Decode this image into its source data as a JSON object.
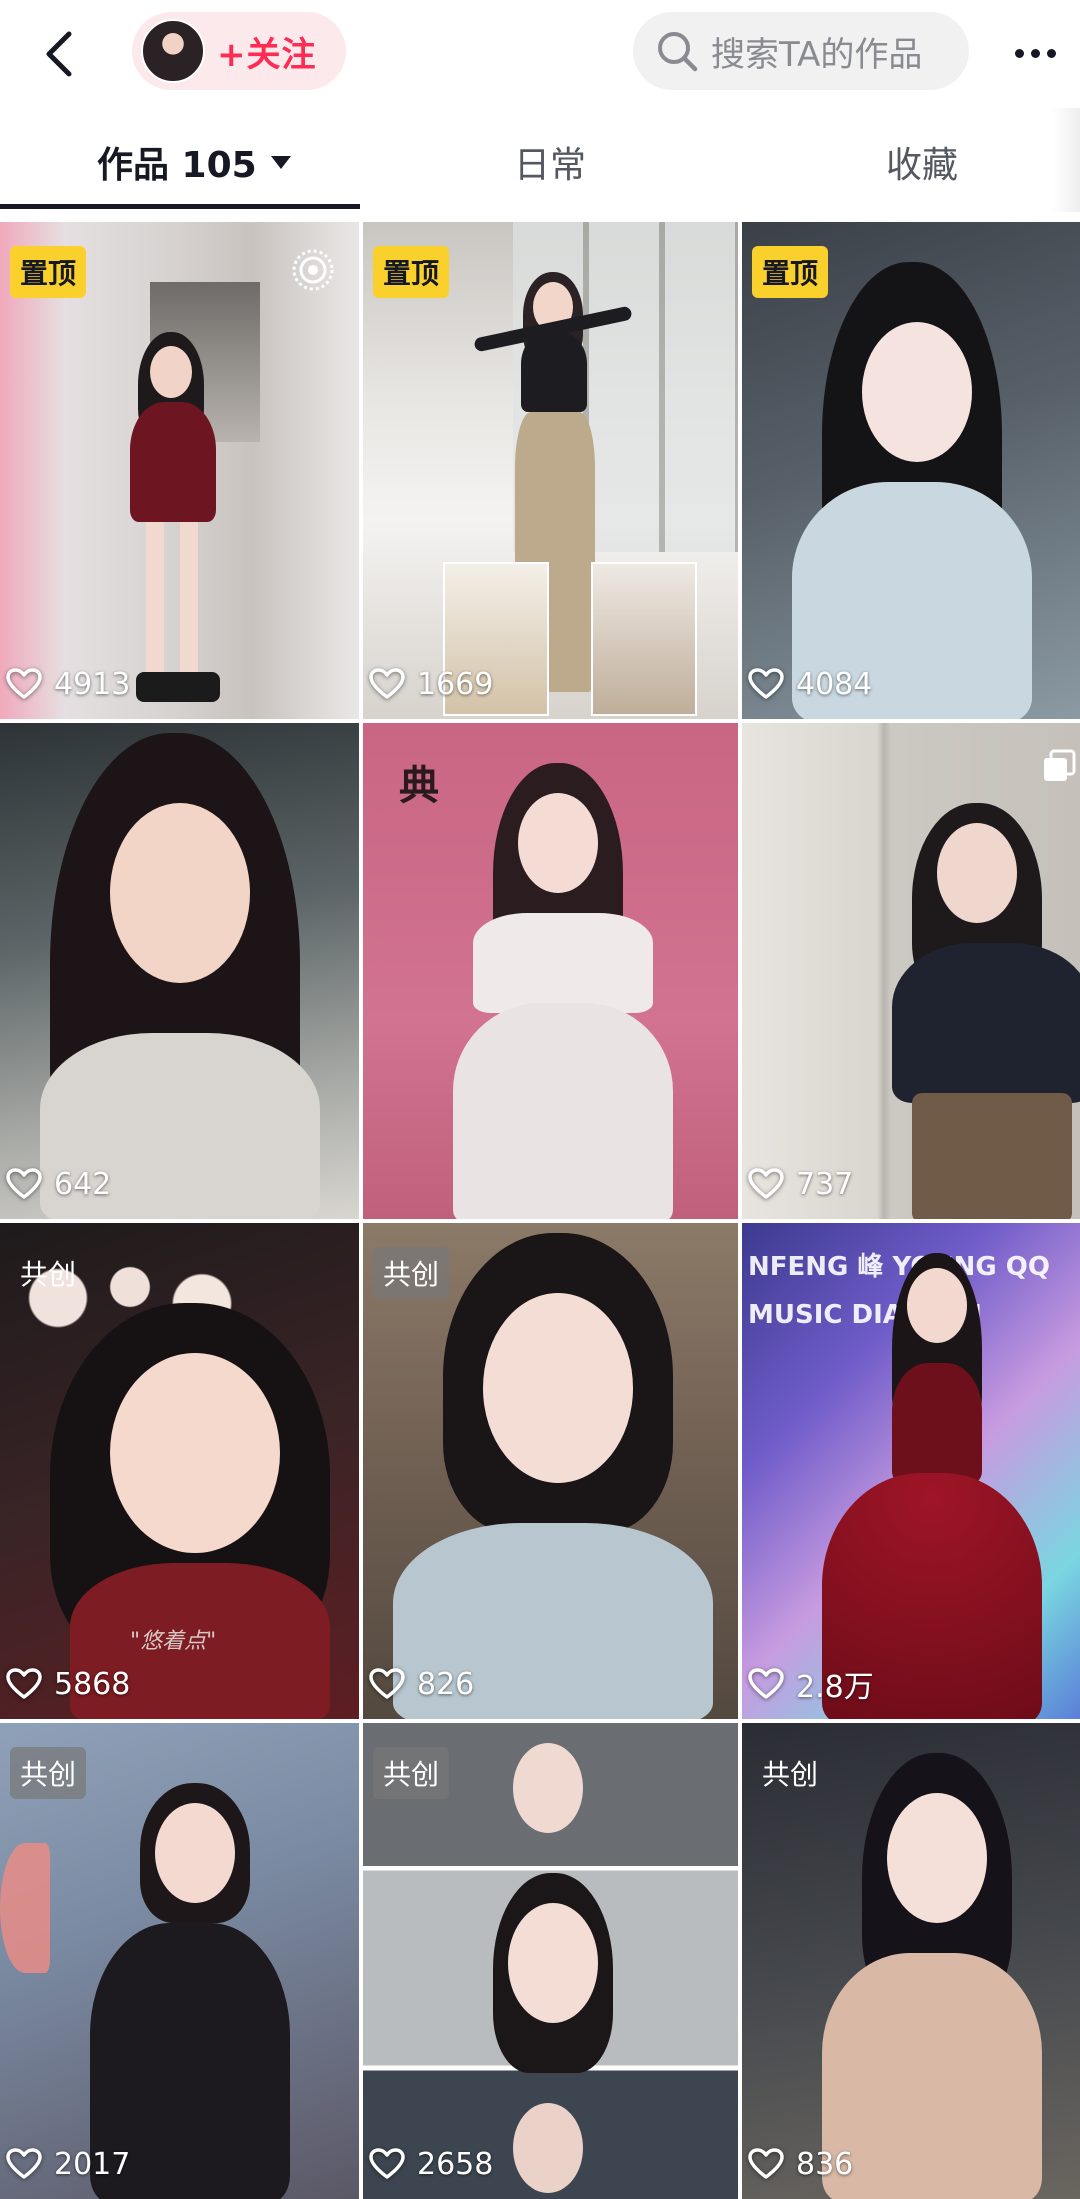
{
  "header": {
    "follow_label": "+关注",
    "search_placeholder": "搜索TA的作品"
  },
  "tabs": [
    {
      "label": "作品 105",
      "selected": true
    },
    {
      "label": "日常",
      "selected": false
    },
    {
      "label": "收藏",
      "selected": false
    }
  ],
  "videos": [
    {
      "badge": "置顶",
      "badge_type": "pin",
      "likes": "4913",
      "icon": "live-photo-icon"
    },
    {
      "badge": "置顶",
      "badge_type": "pin",
      "likes": "1669"
    },
    {
      "badge": "置顶",
      "badge_type": "pin",
      "likes": "4084"
    },
    {
      "badge": "",
      "likes": "642"
    },
    {
      "badge": "",
      "likes": "",
      "overlay_text": "典"
    },
    {
      "badge": "",
      "likes": "737",
      "icon": "multi-image-icon"
    },
    {
      "badge": "共创",
      "badge_type": "co",
      "likes": "5868",
      "overlay_text": "\"悠着点\""
    },
    {
      "badge": "共创",
      "badge_type": "co",
      "likes": "826"
    },
    {
      "badge": "",
      "likes": "2.8万",
      "overlay_text": "NFENG 峰 YOUNG QQMUSIC DIANFEN"
    },
    {
      "badge": "共创",
      "badge_type": "co",
      "likes": "2017"
    },
    {
      "badge": "共创",
      "badge_type": "co",
      "likes": "2658"
    },
    {
      "badge": "共创",
      "badge_type": "co",
      "likes": "836"
    }
  ],
  "colors": {
    "accent": "#fe2c55",
    "pin_badge": "#fad02c",
    "text": "#161823"
  }
}
